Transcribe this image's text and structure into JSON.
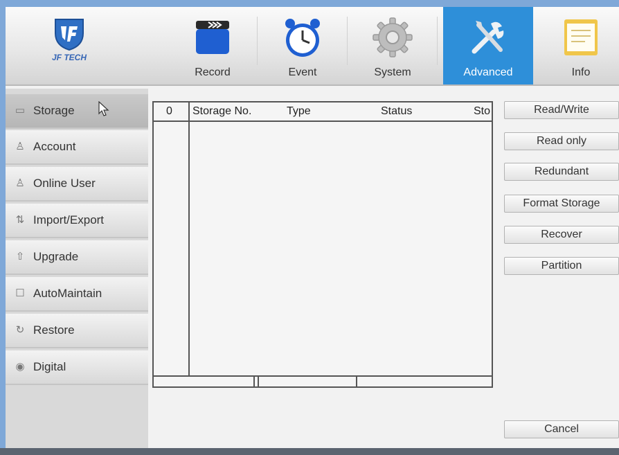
{
  "brand": {
    "logo_text": "JF TECH"
  },
  "nav": {
    "tabs": [
      {
        "label": "Record",
        "icon": "clapperboard-icon"
      },
      {
        "label": "Event",
        "icon": "alarm-clock-icon"
      },
      {
        "label": "System",
        "icon": "gear-icon"
      },
      {
        "label": "Advanced",
        "icon": "tools-icon",
        "active": true
      },
      {
        "label": "Info",
        "icon": "document-icon"
      }
    ],
    "active_color": "#2e8fd9"
  },
  "sidebar": {
    "items": [
      {
        "label": "Storage",
        "icon": "hard-disk-icon",
        "active": true
      },
      {
        "label": "Account",
        "icon": "user-icon"
      },
      {
        "label": "Online User",
        "icon": "users-icon"
      },
      {
        "label": "Import/Export",
        "icon": "import-export-icon"
      },
      {
        "label": "Upgrade",
        "icon": "upgrade-icon"
      },
      {
        "label": "AutoMaintain",
        "icon": "maintain-icon"
      },
      {
        "label": "Restore",
        "icon": "restore-icon"
      },
      {
        "label": "Digital",
        "icon": "digital-icon"
      }
    ]
  },
  "storage_table": {
    "columns": [
      "0",
      "Storage No.",
      "Type",
      "Status",
      "Sto"
    ],
    "rows": []
  },
  "actions": {
    "read_write": "Read/Write",
    "read_only": "Read only",
    "redundant": "Redundant",
    "format_storage": "Format Storage",
    "recover": "Recover",
    "partition": "Partition",
    "cancel": "Cancel"
  }
}
